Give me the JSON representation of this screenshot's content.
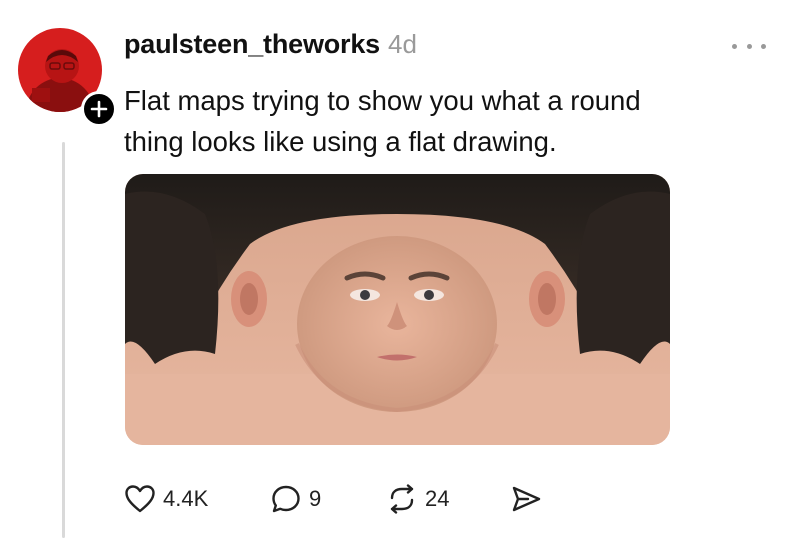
{
  "post": {
    "username": "paulsteen_theworks",
    "timestamp": "4d",
    "caption_line1": "Flat maps trying to show you what a round",
    "caption_line2": "thing looks like using a flat drawing.",
    "media_icon": "unwrapped-face-photo",
    "avatar_icon": "red-profile-avatar",
    "colors": {
      "avatar_bg": "#d61e1e",
      "text": "#111111",
      "muted": "#9a9a9a",
      "thread_line": "#d9d9d9"
    }
  },
  "actions": {
    "likes": "4.4K",
    "replies": "9",
    "reposts": "24",
    "like_icon": "heart-icon",
    "reply_icon": "comment-icon",
    "repost_icon": "repost-icon",
    "share_icon": "send-icon"
  }
}
